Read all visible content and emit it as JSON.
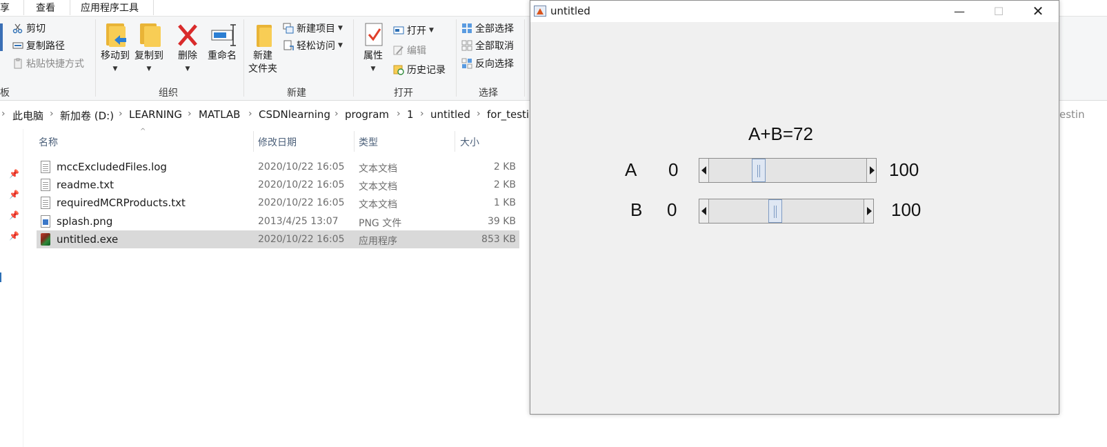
{
  "explorer": {
    "tabs": [
      "享",
      "查看",
      "应用程序工具"
    ],
    "ribbon": {
      "clipboard": {
        "cut": "剪切",
        "copy_path": "复制路径",
        "paste_shortcut": "粘贴快捷方式",
        "group_label": "板"
      },
      "organize": {
        "move_to": "移动到",
        "copy_to": "复制到",
        "delete": "删除",
        "rename": "重命名",
        "group_label": "组织"
      },
      "new": {
        "new_folder_line1": "新建",
        "new_folder_line2": "文件夹",
        "new_item": "新建项目",
        "easy_access": "轻松访问",
        "group_label": "新建"
      },
      "open": {
        "properties": "属性",
        "open": "打开",
        "edit": "编辑",
        "history": "历史记录",
        "group_label": "打开"
      },
      "select": {
        "select_all": "全部选择",
        "select_none": "全部取消",
        "invert": "反向选择",
        "group_label": "选择"
      }
    },
    "breadcrumb": [
      "此电脑",
      "新加卷 (D:)",
      "LEARNING",
      "MATLAB",
      "CSDNlearning",
      "program",
      "1",
      "untitled",
      "for_testin"
    ],
    "search_hint": "estin",
    "columns": {
      "name": "名称",
      "modified": "修改日期",
      "type": "类型",
      "size": "大小"
    },
    "files": [
      {
        "name": "mccExcludedFiles.log",
        "modified": "2020/10/22 16:05",
        "type": "文本文档",
        "size": "2 KB",
        "icon": "text-file-icon"
      },
      {
        "name": "readme.txt",
        "modified": "2020/10/22 16:05",
        "type": "文本文档",
        "size": "2 KB",
        "icon": "text-file-icon"
      },
      {
        "name": "requiredMCRProducts.txt",
        "modified": "2020/10/22 16:05",
        "type": "文本文档",
        "size": "1 KB",
        "icon": "text-file-icon"
      },
      {
        "name": "splash.png",
        "modified": "2013/4/25 13:07",
        "type": "PNG 文件",
        "size": "39 KB",
        "icon": "image-file-icon"
      },
      {
        "name": "untitled.exe",
        "modified": "2020/10/22 16:05",
        "type": "应用程序",
        "size": "853 KB",
        "icon": "matlab-exe-icon",
        "selected": true
      }
    ]
  },
  "figure": {
    "title": "untitled",
    "result_label": "A+B=72",
    "slider_a": {
      "label": "A",
      "min_label": "0",
      "max_label": "100",
      "value": 30
    },
    "slider_b": {
      "label": "B",
      "min_label": "0",
      "max_label": "100",
      "value": 42
    }
  },
  "colors": {
    "ribbon_bg": "#f5f6f7",
    "selection": "#d9d9d9",
    "figure_bg": "#f0f0f0",
    "slider_thumb": "#dfe7f3"
  }
}
